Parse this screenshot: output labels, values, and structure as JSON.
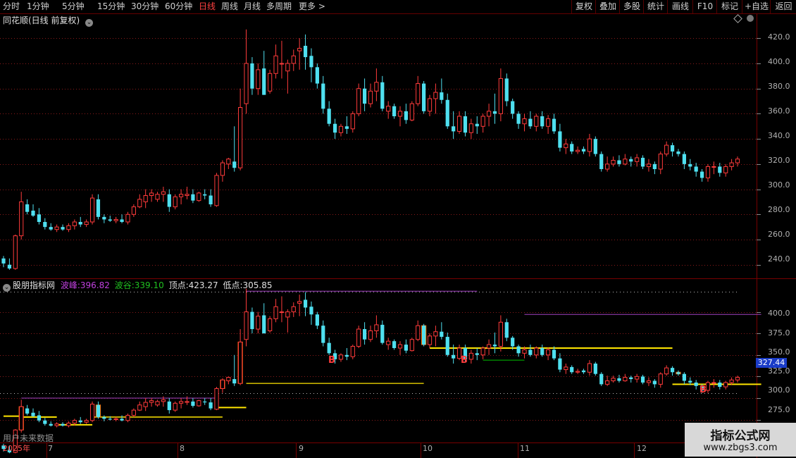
{
  "toolbar": {
    "periods": [
      "分时",
      "1分钟",
      "5分钟",
      "15分钟",
      "30分钟",
      "60分钟",
      "日线",
      "周线",
      "月线",
      "多周期",
      "更多 >"
    ],
    "active_period": "日线",
    "right_buttons": [
      "复权",
      "叠加",
      "多股",
      "统计",
      "画线",
      "F10",
      "+自选",
      "返回"
    ],
    "mark_label": "标记"
  },
  "main_panel": {
    "title": "同花顺(日线 前复权)",
    "y_ticks": [
      "420.0",
      "400.0",
      "380.0",
      "360.0",
      "340.0",
      "320.0",
      "300.0",
      "280.0",
      "260.0",
      "240.0"
    ]
  },
  "indicator_panel": {
    "name": "股朋指标网",
    "peak_label": "波峰:",
    "peak_value": "396.82",
    "valley_label": "波谷:",
    "valley_value": "339.10",
    "top_label": "顶点:",
    "top_value": "423.27",
    "low_label": "低点:",
    "low_value": "305.85",
    "y_ticks": [
      "400.0",
      "375.0",
      "350.0",
      "325.0",
      "300.0",
      "275.0"
    ],
    "price_tag": "327.44",
    "buy_marker": "B",
    "future_label": "用户未来数据"
  },
  "x_axis": {
    "labels": [
      "2025年",
      "7",
      "8",
      "9",
      "10",
      "11",
      "12"
    ]
  },
  "watermark": {
    "title": "指标公式网",
    "url": "www.zbgs3.com"
  },
  "colors": {
    "up": "#ff3b3b",
    "down": "#4fe0f0",
    "grid": "#8a1a1a",
    "yellow": "#ffe600",
    "purple": "#a040c0",
    "green": "#00c000"
  },
  "chart_data": {
    "type": "candlestick",
    "title": "同花顺(日线 前复权)",
    "ylim": [
      232,
      428
    ],
    "ohlc": [
      [
        245,
        247,
        238,
        241
      ],
      [
        240,
        245,
        236,
        237
      ],
      [
        237,
        264,
        236,
        263
      ],
      [
        263,
        298,
        260,
        290
      ],
      [
        288,
        292,
        280,
        282
      ],
      [
        283,
        288,
        278,
        279
      ],
      [
        280,
        285,
        272,
        274
      ],
      [
        274,
        277,
        268,
        270
      ],
      [
        270,
        273,
        267,
        268
      ],
      [
        268,
        272,
        266,
        270
      ],
      [
        270,
        272,
        267,
        268
      ],
      [
        268,
        273,
        266,
        271
      ],
      [
        271,
        276,
        268,
        274
      ],
      [
        274,
        278,
        270,
        272
      ],
      [
        272,
        276,
        270,
        274
      ],
      [
        274,
        296,
        272,
        293
      ],
      [
        292,
        296,
        276,
        278
      ],
      [
        278,
        280,
        273,
        276
      ],
      [
        276,
        279,
        274,
        275
      ],
      [
        275,
        278,
        273,
        276
      ],
      [
        276,
        280,
        273,
        274
      ],
      [
        274,
        282,
        272,
        280
      ],
      [
        280,
        288,
        278,
        286
      ],
      [
        286,
        296,
        285,
        292
      ],
      [
        290,
        300,
        285,
        295
      ],
      [
        295,
        300,
        290,
        297
      ],
      [
        292,
        298,
        290,
        296
      ],
      [
        296,
        302,
        290,
        298
      ],
      [
        296,
        300,
        282,
        286
      ],
      [
        286,
        296,
        284,
        294
      ],
      [
        294,
        300,
        288,
        296
      ],
      [
        295,
        302,
        292,
        296
      ],
      [
        296,
        300,
        289,
        291
      ],
      [
        291,
        298,
        290,
        297
      ],
      [
        296,
        300,
        292,
        295
      ],
      [
        295,
        300,
        286,
        288
      ],
      [
        287,
        313,
        286,
        311
      ],
      [
        311,
        323,
        306,
        321
      ],
      [
        320,
        325,
        316,
        324
      ],
      [
        322,
        350,
        314,
        317
      ],
      [
        317,
        380,
        315,
        365
      ],
      [
        368,
        427,
        360,
        400
      ],
      [
        400,
        405,
        375,
        380
      ],
      [
        380,
        400,
        375,
        395
      ],
      [
        396,
        410,
        375,
        375
      ],
      [
        378,
        395,
        376,
        392
      ],
      [
        392,
        415,
        388,
        406
      ],
      [
        400,
        418,
        388,
        400
      ],
      [
        394,
        403,
        376,
        400
      ],
      [
        400,
        411,
        394,
        406
      ],
      [
        410,
        420,
        395,
        412
      ],
      [
        414,
        423,
        395,
        405
      ],
      [
        406,
        412,
        385,
        397
      ],
      [
        397,
        400,
        380,
        384
      ],
      [
        384,
        390,
        360,
        364
      ],
      [
        364,
        370,
        350,
        352
      ],
      [
        352,
        356,
        340,
        345
      ],
      [
        345,
        352,
        342,
        350
      ],
      [
        350,
        358,
        344,
        348
      ],
      [
        348,
        362,
        345,
        360
      ],
      [
        360,
        384,
        358,
        380
      ],
      [
        380,
        388,
        362,
        368
      ],
      [
        368,
        384,
        365,
        378
      ],
      [
        378,
        396,
        370,
        385
      ],
      [
        385,
        390,
        362,
        364
      ],
      [
        362,
        370,
        356,
        366
      ],
      [
        366,
        368,
        356,
        358
      ],
      [
        358,
        366,
        350,
        362
      ],
      [
        362,
        368,
        352,
        355
      ],
      [
        355,
        370,
        354,
        368
      ],
      [
        368,
        390,
        366,
        384
      ],
      [
        384,
        386,
        360,
        362
      ],
      [
        362,
        375,
        358,
        372
      ],
      [
        372,
        384,
        360,
        377
      ],
      [
        377,
        388,
        368,
        371
      ],
      [
        371,
        376,
        348,
        350
      ],
      [
        350,
        362,
        340,
        346
      ],
      [
        346,
        362,
        344,
        358
      ],
      [
        358,
        362,
        342,
        345
      ],
      [
        345,
        356,
        340,
        352
      ],
      [
        352,
        358,
        344,
        350
      ],
      [
        350,
        360,
        345,
        358
      ],
      [
        358,
        368,
        350,
        362
      ],
      [
        362,
        376,
        352,
        360
      ],
      [
        360,
        396,
        354,
        388
      ],
      [
        388,
        392,
        366,
        370
      ],
      [
        370,
        372,
        356,
        360
      ],
      [
        360,
        362,
        348,
        352
      ],
      [
        352,
        360,
        346,
        356
      ],
      [
        356,
        362,
        348,
        350
      ],
      [
        350,
        360,
        346,
        358
      ],
      [
        358,
        362,
        348,
        350
      ],
      [
        350,
        359,
        344,
        356
      ],
      [
        356,
        360,
        344,
        346
      ],
      [
        346,
        352,
        330,
        333
      ],
      [
        333,
        340,
        328,
        336
      ],
      [
        336,
        338,
        328,
        330
      ],
      [
        330,
        334,
        328,
        331
      ],
      [
        332,
        334,
        328,
        330
      ],
      [
        330,
        344,
        326,
        340
      ],
      [
        340,
        342,
        326,
        328
      ],
      [
        328,
        330,
        314,
        316
      ],
      [
        316,
        326,
        314,
        320
      ],
      [
        320,
        326,
        318,
        323
      ],
      [
        323,
        327,
        318,
        320
      ],
      [
        320,
        328,
        319,
        324
      ],
      [
        324,
        326,
        318,
        322
      ],
      [
        322,
        328,
        318,
        325
      ],
      [
        325,
        327,
        316,
        318
      ],
      [
        318,
        324,
        314,
        320
      ],
      [
        320,
        322,
        312,
        316
      ],
      [
        316,
        330,
        312,
        328
      ],
      [
        328,
        338,
        326,
        335
      ],
      [
        335,
        337,
        326,
        330
      ],
      [
        330,
        332,
        326,
        328
      ],
      [
        328,
        330,
        316,
        320
      ],
      [
        320,
        324,
        315,
        318
      ],
      [
        318,
        321,
        310,
        314
      ],
      [
        314,
        316,
        306,
        309
      ],
      [
        309,
        320,
        306,
        318
      ],
      [
        318,
        322,
        312,
        318
      ],
      [
        318,
        321,
        310,
        313
      ],
      [
        313,
        320,
        310,
        318
      ],
      [
        318,
        324,
        315,
        321
      ],
      [
        321,
        326,
        318,
        324
      ]
    ],
    "indicator": {
      "name": "股朋指标网",
      "ylim": [
        255,
        425
      ],
      "peak": 396.82,
      "valley": 339.1,
      "top": 423.27,
      "low": 305.85
    }
  }
}
